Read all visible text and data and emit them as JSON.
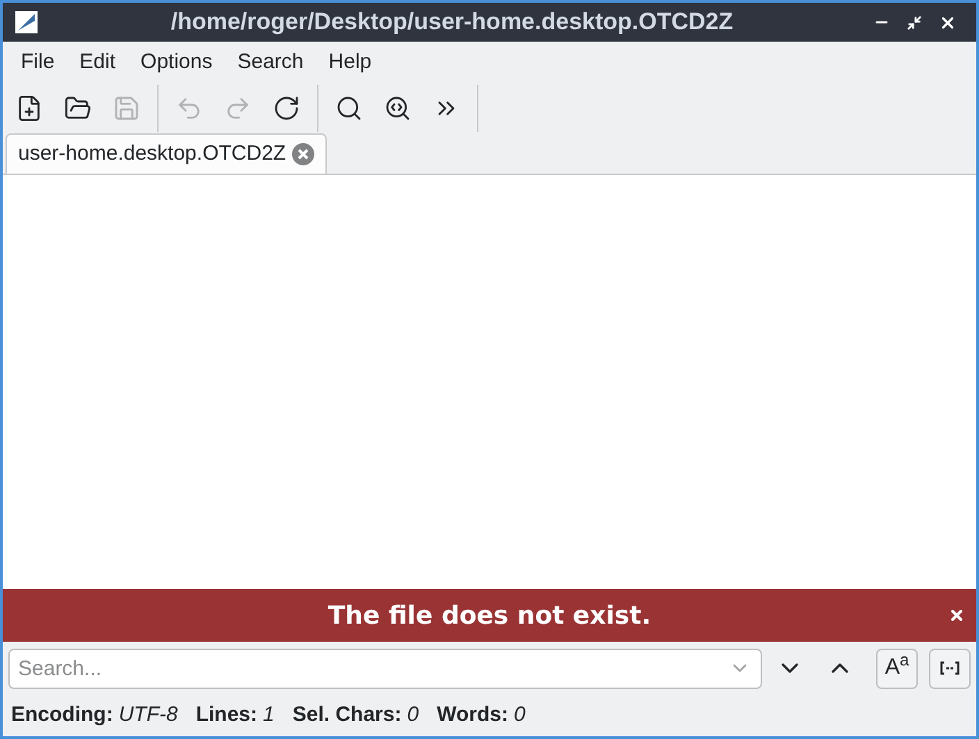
{
  "window": {
    "title": "/home/roger/Desktop/user-home.desktop.OTCD2Z"
  },
  "menu": [
    "File",
    "Edit",
    "Options",
    "Search",
    "Help"
  ],
  "toolbar": [
    {
      "kind": "new",
      "disabled": false
    },
    {
      "kind": "open",
      "disabled": false
    },
    {
      "kind": "save",
      "disabled": true
    },
    {
      "kind": "sep"
    },
    {
      "kind": "undo",
      "disabled": true
    },
    {
      "kind": "redo",
      "disabled": true
    },
    {
      "kind": "reload",
      "disabled": false
    },
    {
      "kind": "sep"
    },
    {
      "kind": "find",
      "disabled": false
    },
    {
      "kind": "replace",
      "disabled": false
    },
    {
      "kind": "more",
      "disabled": false
    },
    {
      "kind": "sep"
    }
  ],
  "tabs": [
    {
      "label": "user-home.desktop.OTCD2Z",
      "selected": true
    }
  ],
  "error_bar": {
    "message": "The file does not exist."
  },
  "search": {
    "placeholder": "Search...",
    "case_button": "A$^{a}$"
  },
  "status_bar": [
    {
      "label": "Encoding:",
      "value": "UTF-8"
    },
    {
      "label": "Lines:",
      "value": "1"
    },
    {
      "label": "Sel. Chars:",
      "value": "0"
    },
    {
      "label": "Words:",
      "value": "0"
    }
  ]
}
